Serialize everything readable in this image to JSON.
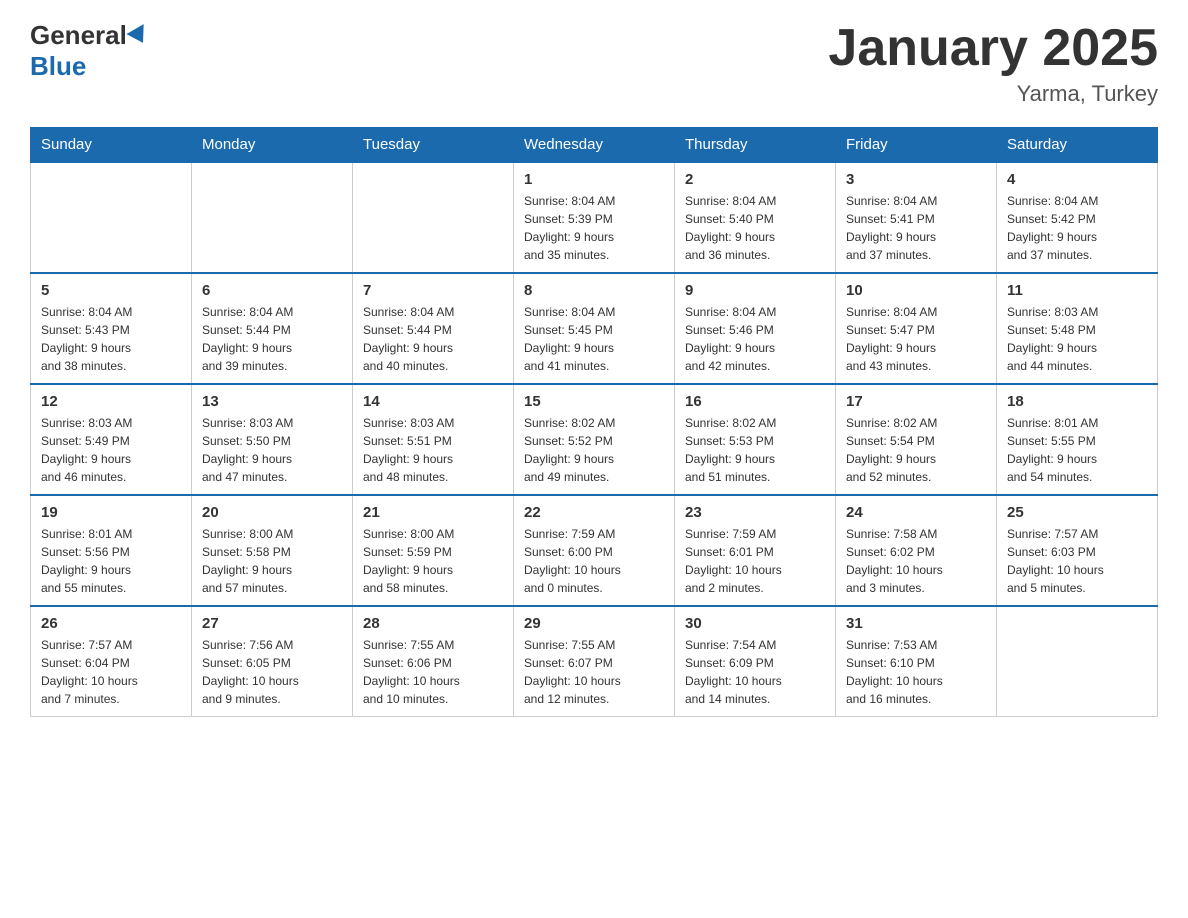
{
  "logo": {
    "general": "General",
    "blue": "Blue"
  },
  "title": "January 2025",
  "location": "Yarma, Turkey",
  "days_of_week": [
    "Sunday",
    "Monday",
    "Tuesday",
    "Wednesday",
    "Thursday",
    "Friday",
    "Saturday"
  ],
  "weeks": [
    [
      {
        "day": "",
        "info": ""
      },
      {
        "day": "",
        "info": ""
      },
      {
        "day": "",
        "info": ""
      },
      {
        "day": "1",
        "info": "Sunrise: 8:04 AM\nSunset: 5:39 PM\nDaylight: 9 hours\nand 35 minutes."
      },
      {
        "day": "2",
        "info": "Sunrise: 8:04 AM\nSunset: 5:40 PM\nDaylight: 9 hours\nand 36 minutes."
      },
      {
        "day": "3",
        "info": "Sunrise: 8:04 AM\nSunset: 5:41 PM\nDaylight: 9 hours\nand 37 minutes."
      },
      {
        "day": "4",
        "info": "Sunrise: 8:04 AM\nSunset: 5:42 PM\nDaylight: 9 hours\nand 37 minutes."
      }
    ],
    [
      {
        "day": "5",
        "info": "Sunrise: 8:04 AM\nSunset: 5:43 PM\nDaylight: 9 hours\nand 38 minutes."
      },
      {
        "day": "6",
        "info": "Sunrise: 8:04 AM\nSunset: 5:44 PM\nDaylight: 9 hours\nand 39 minutes."
      },
      {
        "day": "7",
        "info": "Sunrise: 8:04 AM\nSunset: 5:44 PM\nDaylight: 9 hours\nand 40 minutes."
      },
      {
        "day": "8",
        "info": "Sunrise: 8:04 AM\nSunset: 5:45 PM\nDaylight: 9 hours\nand 41 minutes."
      },
      {
        "day": "9",
        "info": "Sunrise: 8:04 AM\nSunset: 5:46 PM\nDaylight: 9 hours\nand 42 minutes."
      },
      {
        "day": "10",
        "info": "Sunrise: 8:04 AM\nSunset: 5:47 PM\nDaylight: 9 hours\nand 43 minutes."
      },
      {
        "day": "11",
        "info": "Sunrise: 8:03 AM\nSunset: 5:48 PM\nDaylight: 9 hours\nand 44 minutes."
      }
    ],
    [
      {
        "day": "12",
        "info": "Sunrise: 8:03 AM\nSunset: 5:49 PM\nDaylight: 9 hours\nand 46 minutes."
      },
      {
        "day": "13",
        "info": "Sunrise: 8:03 AM\nSunset: 5:50 PM\nDaylight: 9 hours\nand 47 minutes."
      },
      {
        "day": "14",
        "info": "Sunrise: 8:03 AM\nSunset: 5:51 PM\nDaylight: 9 hours\nand 48 minutes."
      },
      {
        "day": "15",
        "info": "Sunrise: 8:02 AM\nSunset: 5:52 PM\nDaylight: 9 hours\nand 49 minutes."
      },
      {
        "day": "16",
        "info": "Sunrise: 8:02 AM\nSunset: 5:53 PM\nDaylight: 9 hours\nand 51 minutes."
      },
      {
        "day": "17",
        "info": "Sunrise: 8:02 AM\nSunset: 5:54 PM\nDaylight: 9 hours\nand 52 minutes."
      },
      {
        "day": "18",
        "info": "Sunrise: 8:01 AM\nSunset: 5:55 PM\nDaylight: 9 hours\nand 54 minutes."
      }
    ],
    [
      {
        "day": "19",
        "info": "Sunrise: 8:01 AM\nSunset: 5:56 PM\nDaylight: 9 hours\nand 55 minutes."
      },
      {
        "day": "20",
        "info": "Sunrise: 8:00 AM\nSunset: 5:58 PM\nDaylight: 9 hours\nand 57 minutes."
      },
      {
        "day": "21",
        "info": "Sunrise: 8:00 AM\nSunset: 5:59 PM\nDaylight: 9 hours\nand 58 minutes."
      },
      {
        "day": "22",
        "info": "Sunrise: 7:59 AM\nSunset: 6:00 PM\nDaylight: 10 hours\nand 0 minutes."
      },
      {
        "day": "23",
        "info": "Sunrise: 7:59 AM\nSunset: 6:01 PM\nDaylight: 10 hours\nand 2 minutes."
      },
      {
        "day": "24",
        "info": "Sunrise: 7:58 AM\nSunset: 6:02 PM\nDaylight: 10 hours\nand 3 minutes."
      },
      {
        "day": "25",
        "info": "Sunrise: 7:57 AM\nSunset: 6:03 PM\nDaylight: 10 hours\nand 5 minutes."
      }
    ],
    [
      {
        "day": "26",
        "info": "Sunrise: 7:57 AM\nSunset: 6:04 PM\nDaylight: 10 hours\nand 7 minutes."
      },
      {
        "day": "27",
        "info": "Sunrise: 7:56 AM\nSunset: 6:05 PM\nDaylight: 10 hours\nand 9 minutes."
      },
      {
        "day": "28",
        "info": "Sunrise: 7:55 AM\nSunset: 6:06 PM\nDaylight: 10 hours\nand 10 minutes."
      },
      {
        "day": "29",
        "info": "Sunrise: 7:55 AM\nSunset: 6:07 PM\nDaylight: 10 hours\nand 12 minutes."
      },
      {
        "day": "30",
        "info": "Sunrise: 7:54 AM\nSunset: 6:09 PM\nDaylight: 10 hours\nand 14 minutes."
      },
      {
        "day": "31",
        "info": "Sunrise: 7:53 AM\nSunset: 6:10 PM\nDaylight: 10 hours\nand 16 minutes."
      },
      {
        "day": "",
        "info": ""
      }
    ]
  ]
}
